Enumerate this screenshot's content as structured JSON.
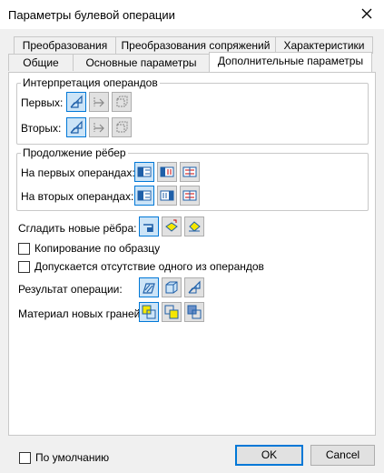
{
  "window": {
    "title": "Параметры булевой операции",
    "close_icon": "close-icon"
  },
  "tabs": {
    "back_row": [
      "Преобразования",
      "Преобразования сопряжений",
      "Характеристики"
    ],
    "front_row": [
      "Общие",
      "Основные параметры",
      "Дополнительные параметры"
    ],
    "active": "Дополнительные параметры"
  },
  "interpretation": {
    "legend": "Интерпретация операндов",
    "first_label": "Первых:",
    "second_label": "Вторых:",
    "selected": "solid"
  },
  "edges": {
    "legend": "Продолжение рёбер",
    "first_label": "На первых операндах:",
    "second_label": "На вторых операндах:",
    "selected": "first"
  },
  "smooth": {
    "label": "Сгладить новые рёбра:",
    "selected": "first"
  },
  "checkboxes": {
    "copy_pattern": {
      "label": "Копирование по образцу",
      "checked": false
    },
    "allow_missing": {
      "label": "Допускается отсутствие одного из операндов",
      "checked": false
    }
  },
  "result": {
    "label": "Результат операции:",
    "selected": "first"
  },
  "material": {
    "label": "Материал новых граней:",
    "selected": "first"
  },
  "footer": {
    "default_label": "По умолчанию",
    "default_checked": false,
    "ok_label": "OK",
    "cancel_label": "Cancel"
  },
  "colors": {
    "accent": "#0078d7",
    "selected_bg": "#cce4f7",
    "yellow": "#f5e600",
    "blue_icon": "#1f5fa8"
  }
}
